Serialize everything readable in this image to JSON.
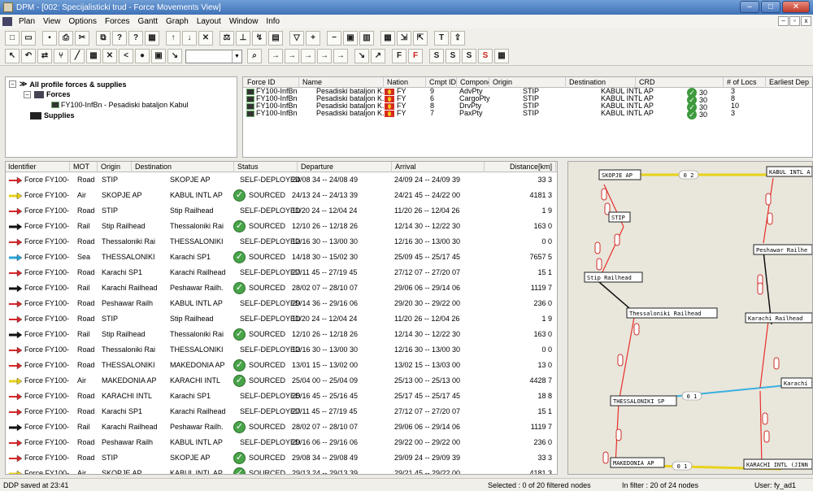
{
  "window": {
    "title": "DPM - [002: Specijalisticki trud - Force Movements View]"
  },
  "menu": [
    "Plan",
    "View",
    "Options",
    "Forces",
    "Gantt",
    "Graph",
    "Layout",
    "Window",
    "Info"
  ],
  "toolbar1": [
    "new-icon",
    "open-icon",
    "save-icon",
    "print-icon",
    "cut-icon",
    "copy-icon",
    "help-icon",
    "whatsthis-icon",
    "grid-icon",
    "move-up-icon",
    "move-down-icon",
    "delete-icon",
    "scale-icon",
    "balance-icon",
    "flow-icon",
    "chart-icon",
    "filter-icon",
    "zoom-in-icon",
    "zoom-out-icon",
    "fit-icon",
    "layout-icon",
    "table-icon",
    "expand-icon",
    "collapse-icon",
    "text-icon",
    "export-icon"
  ],
  "toolbar2": {
    "icons": [
      "pointer-icon",
      "undo-icon",
      "link-icon",
      "branch-icon",
      "line-icon",
      "grid-icon",
      "cross-icon",
      "route-icon",
      "globe-icon",
      "window-icon",
      "arrow-icon"
    ],
    "combo_value": "",
    "right_buttons": [
      "F",
      "S",
      "S",
      "S",
      "S"
    ]
  },
  "tree": {
    "root": "All profile forces & supplies",
    "forces_label": "Forces",
    "force_item": "FY100-InfBn - Pesadiski bataljon Kabul",
    "supplies_label": "Supplies"
  },
  "forces_table": {
    "columns": [
      "Force ID",
      "Name",
      "Nation",
      "Cmpt ID",
      "Component Label",
      "Origin",
      "Destination",
      "CRD",
      "# of Locs",
      "Earliest Dep"
    ],
    "rows": [
      {
        "id": "FY100-InfBn",
        "name": "Pesadiski bataljon K..",
        "nation": "FY",
        "cmpt": "9",
        "label": "AdvPty",
        "origin": "STIP",
        "dest": "KABUL INTL AP",
        "crd": "30",
        "locs": "3"
      },
      {
        "id": "FY100-InfBn",
        "name": "Pesadiski bataljon K..",
        "nation": "FY",
        "cmpt": "6",
        "label": "CargoPty",
        "origin": "STIP",
        "dest": "KABUL INTL AP",
        "crd": "30",
        "locs": "8"
      },
      {
        "id": "FY100-InfBn",
        "name": "Pesadiski bataljon K..",
        "nation": "FY",
        "cmpt": "8",
        "label": "DrvPty",
        "origin": "STIP",
        "dest": "KABUL INTL AP",
        "crd": "30",
        "locs": "10"
      },
      {
        "id": "FY100-InfBn",
        "name": "Pesadiski bataljon K..",
        "nation": "FY",
        "cmpt": "7",
        "label": "PaxPty",
        "origin": "STIP",
        "dest": "KABUL INTL AP",
        "crd": "30",
        "locs": "3"
      }
    ]
  },
  "movements": {
    "columns": [
      "Identifier",
      "MOT",
      "Origin",
      "Destination",
      "Status",
      "Departure",
      "Arrival",
      "Distance[km]"
    ],
    "colors": {
      "Road": "#d9262a",
      "Air": "#e8d21c",
      "Rail": "#111111",
      "Sea": "#2aa7d9"
    },
    "rows": [
      {
        "id": "Force FY100-",
        "mot": "Road",
        "origin": "STIP",
        "dest": "SKOPJE AP",
        "status": "SELF-DEPLOYED",
        "sourced": false,
        "dep": "24/08 34 -- 24/08 49",
        "arr": "24/09 24 -- 24/09 39",
        "dist": "33 3"
      },
      {
        "id": "Force FY100-",
        "mot": "Air",
        "origin": "SKOPJE AP",
        "dest": "KABUL INTL AP",
        "status": "SOURCED",
        "sourced": true,
        "dep": "24/13 24 -- 24/13 39",
        "arr": "24/21 45 -- 24/22 00",
        "dist": "4181 3"
      },
      {
        "id": "Force FY100-",
        "mot": "Road",
        "origin": "STIP",
        "dest": "Stip Railhead",
        "status": "SELF-DEPLOYED",
        "sourced": false,
        "dep": "11/20 24 -- 12/04 24",
        "arr": "11/20 26 -- 12/04 26",
        "dist": "1 9"
      },
      {
        "id": "Force FY100-",
        "mot": "Rail",
        "origin": "Stip Railhead",
        "dest": "Thessaloniki Rai",
        "status": "SOURCED",
        "sourced": true,
        "dep": "12/10 26 -- 12/18 26",
        "arr": "12/14 30 -- 12/22 30",
        "dist": "163 0"
      },
      {
        "id": "Force FY100-",
        "mot": "Road",
        "origin": "Thessaloniki Rai",
        "dest": "THESSALONIKI",
        "status": "SELF-DEPLOYED",
        "sourced": false,
        "dep": "12/16 30 -- 13/00 30",
        "arr": "12/16 30 -- 13/00 30",
        "dist": "0 0"
      },
      {
        "id": "Force FY100-",
        "mot": "Sea",
        "origin": "THESSALONIKI",
        "dest": "Karachi SP1",
        "status": "SOURCED",
        "sourced": true,
        "dep": "14/18 30 -- 15/02 30",
        "arr": "25/09 45 -- 25/17 45",
        "dist": "7657 5"
      },
      {
        "id": "Force FY100-",
        "mot": "Road",
        "origin": "Karachi SP1",
        "dest": "Karachi Railhead",
        "status": "SELF-DEPLOYED",
        "sourced": false,
        "dep": "27/11 45 -- 27/19 45",
        "arr": "27/12 07 -- 27/20 07",
        "dist": "15 1"
      },
      {
        "id": "Force FY100-",
        "mot": "Rail",
        "origin": "Karachi Railhead",
        "dest": "Peshawar Railh.",
        "status": "SOURCED",
        "sourced": true,
        "dep": "28/02 07 -- 28/10 07",
        "arr": "29/06 06 -- 29/14 06",
        "dist": "1119 7"
      },
      {
        "id": "Force FY100-",
        "mot": "Road",
        "origin": "Peshawar Railh",
        "dest": "KABUL INTL AP",
        "status": "SELF-DEPLOYED",
        "sourced": false,
        "dep": "29/14 36 -- 29/16 06",
        "arr": "29/20 30 -- 29/22 00",
        "dist": "236 0"
      },
      {
        "id": "Force FY100-",
        "mot": "Road",
        "origin": "STIP",
        "dest": "Stip Railhead",
        "status": "SELF-DEPLOYED",
        "sourced": false,
        "dep": "11/20 24 -- 12/04 24",
        "arr": "11/20 26 -- 12/04 26",
        "dist": "1 9"
      },
      {
        "id": "Force FY100-",
        "mot": "Rail",
        "origin": "Stip Railhead",
        "dest": "Thessaloniki Rai",
        "status": "SOURCED",
        "sourced": true,
        "dep": "12/10 26 -- 12/18 26",
        "arr": "12/14 30 -- 12/22 30",
        "dist": "163 0"
      },
      {
        "id": "Force FY100-",
        "mot": "Road",
        "origin": "Thessaloniki Rai",
        "dest": "THESSALONIKI",
        "status": "SELF-DEPLOYED",
        "sourced": false,
        "dep": "12/16 30 -- 13/00 30",
        "arr": "12/16 30 -- 13/00 30",
        "dist": "0 0"
      },
      {
        "id": "Force FY100-",
        "mot": "Road",
        "origin": "THESSALONIKI",
        "dest": "MAKEDONIA AP",
        "status": "SOURCED",
        "sourced": true,
        "dep": "13/01 15 -- 13/02 00",
        "arr": "13/02 15 -- 13/03 00",
        "dist": "13 0"
      },
      {
        "id": "Force FY100-",
        "mot": "Air",
        "origin": "MAKEDONIA AP",
        "dest": "KARACHI INTL",
        "status": "SOURCED",
        "sourced": true,
        "dep": "25/04 00 -- 25/04 09",
        "arr": "25/13 00 -- 25/13 00",
        "dist": "4428 7"
      },
      {
        "id": "Force FY100-",
        "mot": "Road",
        "origin": "KARACHI INTL",
        "dest": "Karachi SP1",
        "status": "SELF-DEPLOYED",
        "sourced": false,
        "dep": "25/16 45 -- 25/16 45",
        "arr": "25/17 45 -- 25/17 45",
        "dist": "18 8"
      },
      {
        "id": "Force FY100-",
        "mot": "Road",
        "origin": "Karachi SP1",
        "dest": "Karachi Railhead",
        "status": "SELF-DEPLOYED",
        "sourced": false,
        "dep": "27/11 45 -- 27/19 45",
        "arr": "27/12 07 -- 27/20 07",
        "dist": "15 1"
      },
      {
        "id": "Force FY100-",
        "mot": "Rail",
        "origin": "Karachi Railhead",
        "dest": "Peshawar Railh.",
        "status": "SOURCED",
        "sourced": true,
        "dep": "28/02 07 -- 28/10 07",
        "arr": "29/06 06 -- 29/14 06",
        "dist": "1119 7"
      },
      {
        "id": "Force FY100-",
        "mot": "Road",
        "origin": "Peshawar Railh",
        "dest": "KABUL INTL AP",
        "status": "SELF-DEPLOYED",
        "sourced": false,
        "dep": "29/16 06 -- 29/16 06",
        "arr": "29/22 00 -- 29/22 00",
        "dist": "236 0"
      },
      {
        "id": "Force FY100-",
        "mot": "Road",
        "origin": "STIP",
        "dest": "SKOPJE AP",
        "status": "SOURCED",
        "sourced": true,
        "dep": "29/08 34 -- 29/08 49",
        "arr": "29/09 24 -- 29/09 39",
        "dist": "33 3"
      },
      {
        "id": "Force FY100-",
        "mot": "Air",
        "origin": "SKOPJE AP",
        "dest": "KABUL INTL AP",
        "status": "SOURCED",
        "sourced": true,
        "dep": "29/13 24 -- 29/13 39",
        "arr": "29/21 45 -- 29/22 00",
        "dist": "4181 3"
      }
    ]
  },
  "graph": {
    "nodes": [
      "SKOPJE AP",
      "KABUL INTL A",
      "STIP",
      "Peshawar Railhe",
      "Stip Railhead",
      "Thessaloniki Railhead",
      "Karachi Railhead",
      "THESSALONIKI SP",
      "Karachi S",
      "MAKEDONIA AP",
      "KARACHI INTL (JINN"
    ],
    "edge_labels": [
      "0 2",
      "0 1",
      "0 1"
    ]
  },
  "status": {
    "left": "DDP saved at 23:41",
    "selected": "Selected : 0 of 20 filtered nodes",
    "filter": "In filter : 20 of 24 nodes",
    "user": "User: fy_ad1"
  }
}
